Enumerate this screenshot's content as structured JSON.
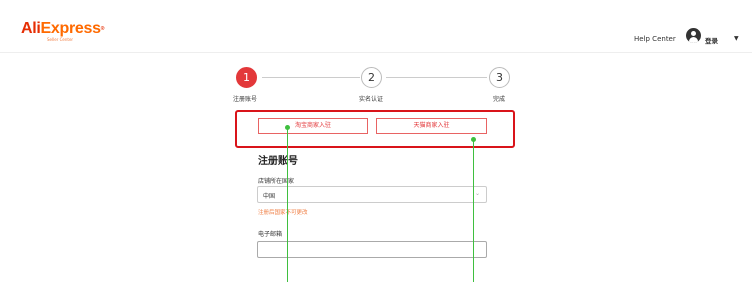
{
  "header": {
    "logo_main_part1": "Ali",
    "logo_main_part2": "Express",
    "logo_sub": "Seller Center",
    "help_center": "Help Center",
    "login_label": "登录"
  },
  "steps": [
    {
      "number": "1",
      "label": "注册账号",
      "state": "active"
    },
    {
      "number": "2",
      "label": "实名认证",
      "state": "inactive"
    },
    {
      "number": "3",
      "label": "完成",
      "state": "inactive"
    }
  ],
  "merchant_buttons": {
    "taobao": "淘宝商家入驻",
    "tmall": "天猫商家入驻"
  },
  "form": {
    "section_title": "注册账号",
    "country_label": "店铺所在国家",
    "country_value": "中国",
    "country_hint": "注册后国家不可更改",
    "email_label": "电子邮箱",
    "email_value": ""
  },
  "colors": {
    "accent": "#e3383a",
    "highlight": "#d9141a",
    "annotation_line": "#3fbf3f",
    "hint": "#f07b3f"
  }
}
